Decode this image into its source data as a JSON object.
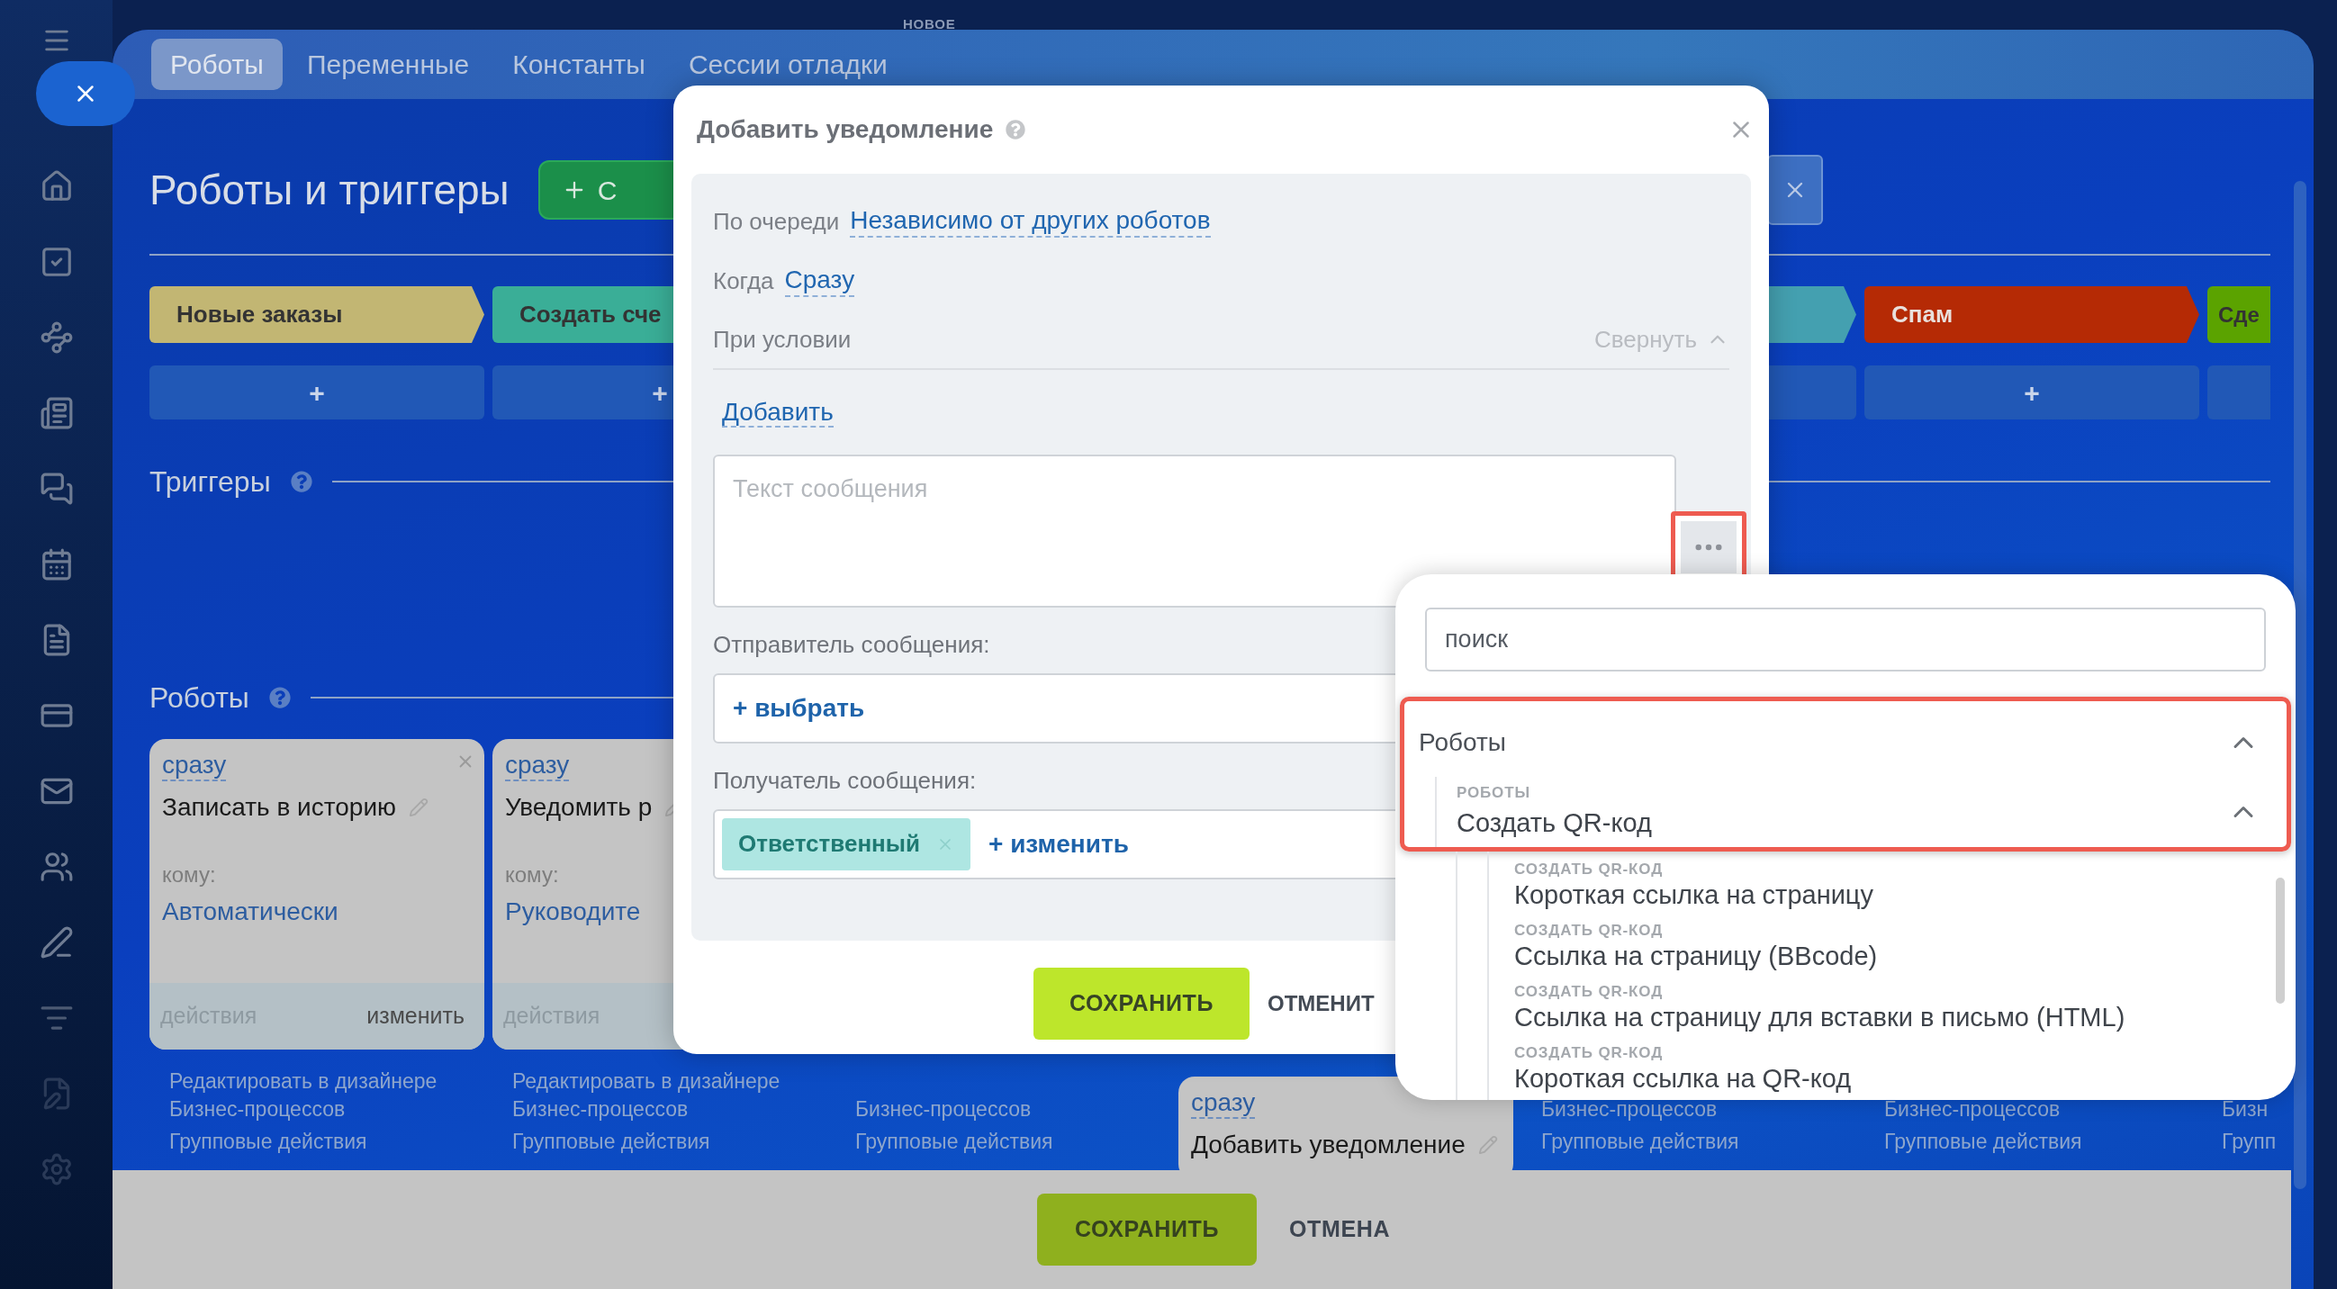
{
  "tabs": [
    {
      "label": "Роботы",
      "selected": true
    },
    {
      "label": "Переменные",
      "selected": false
    },
    {
      "label": "Константы",
      "selected": false
    },
    {
      "label": "Сессии отладки",
      "selected": false,
      "badge": "НОВОЕ"
    }
  ],
  "page": {
    "title": "Роботы и триггеры",
    "create_button": "С"
  },
  "stages": [
    {
      "label": "Новые заказы",
      "color": "#c2b673"
    },
    {
      "label": "Создать сче",
      "color": "#3aae97"
    },
    {
      "color": "#44a0b0"
    },
    {
      "label": "Спам",
      "color": "#b52a05"
    },
    {
      "label": "Сде",
      "color": "#5ba300"
    }
  ],
  "add_buttons": [
    "+",
    "+",
    "+"
  ],
  "triggers": {
    "title": "Триггеры"
  },
  "robots": {
    "title": "Роботы",
    "columns": [
      {
        "cards": [
          {
            "delay": "сразу",
            "title": "Записать в историю",
            "to_label": "кому:",
            "to": "Автоматически",
            "actions": "действия",
            "edit": "изменить"
          }
        ],
        "links": [
          "Редактировать в дизайнере",
          "Бизнес-процессов"
        ],
        "group": "Групповые действия"
      },
      {
        "cards": [
          {
            "delay": "сразу",
            "title": "Уведомить р",
            "to_label": "кому:",
            "to": "Руководите",
            "actions": "действия"
          }
        ],
        "links": [
          "Редактировать в дизайнере",
          "Бизнес-процессов"
        ],
        "group": "Групповые действия"
      },
      {
        "links": [
          "Бизнес-процессов"
        ],
        "group": "Групповые действия"
      },
      {
        "cards": [
          {
            "delay": "сразу",
            "title": "Добавить уведомление"
          }
        ]
      },
      {
        "links": [
          "Бизнес-процессов"
        ],
        "group": "Групповые действия"
      },
      {
        "links": [
          "Бизнес-процессов"
        ],
        "group": "Групповые действия"
      },
      {
        "links": [
          "Бизн"
        ],
        "group": "Групп"
      }
    ]
  },
  "modal": {
    "title": "Добавить уведомление",
    "rows": [
      {
        "label": "По очереди",
        "value": "Независимо от других роботов"
      },
      {
        "label": "Когда",
        "value": "Сразу"
      }
    ],
    "condition": {
      "label": "При условии",
      "toggle": "Свернуть",
      "expanded": true,
      "add": "Добавить"
    },
    "message": {
      "placeholder": "Текст сообщения"
    },
    "sender": {
      "label": "Отправитель сообщения:",
      "action": "+ выбрать"
    },
    "recipient": {
      "label": "Получатель сообщения:",
      "chips": [
        "Ответственный"
      ],
      "action": "+ изменить"
    },
    "save": "СОХРАНИТЬ",
    "cancel": "ОТМЕНИТ"
  },
  "dropdown": {
    "search_placeholder": "поиск",
    "groups": [
      {
        "label": "Роботы",
        "expanded": true,
        "children": [
          {
            "caption": "РОБОТЫ",
            "label": "Создать QR-код",
            "expanded": true,
            "children": [
              {
                "caption": "СОЗДАТЬ QR-КОД",
                "label": "Короткая ссылка на страницу"
              },
              {
                "caption": "СОЗДАТЬ QR-КОД",
                "label": "Ссылка на страницу (BBcode)"
              },
              {
                "caption": "СОЗДАТЬ QR-КОД",
                "label": "Ссылка на страницу для вставки в письмо (HTML)"
              },
              {
                "caption": "СОЗДАТЬ QR-КОД",
                "label": "Короткая ссылка на QR-код"
              }
            ]
          }
        ]
      }
    ]
  },
  "footer": {
    "save": "СОХРАНИТЬ",
    "cancel": "ОТМЕНА"
  }
}
